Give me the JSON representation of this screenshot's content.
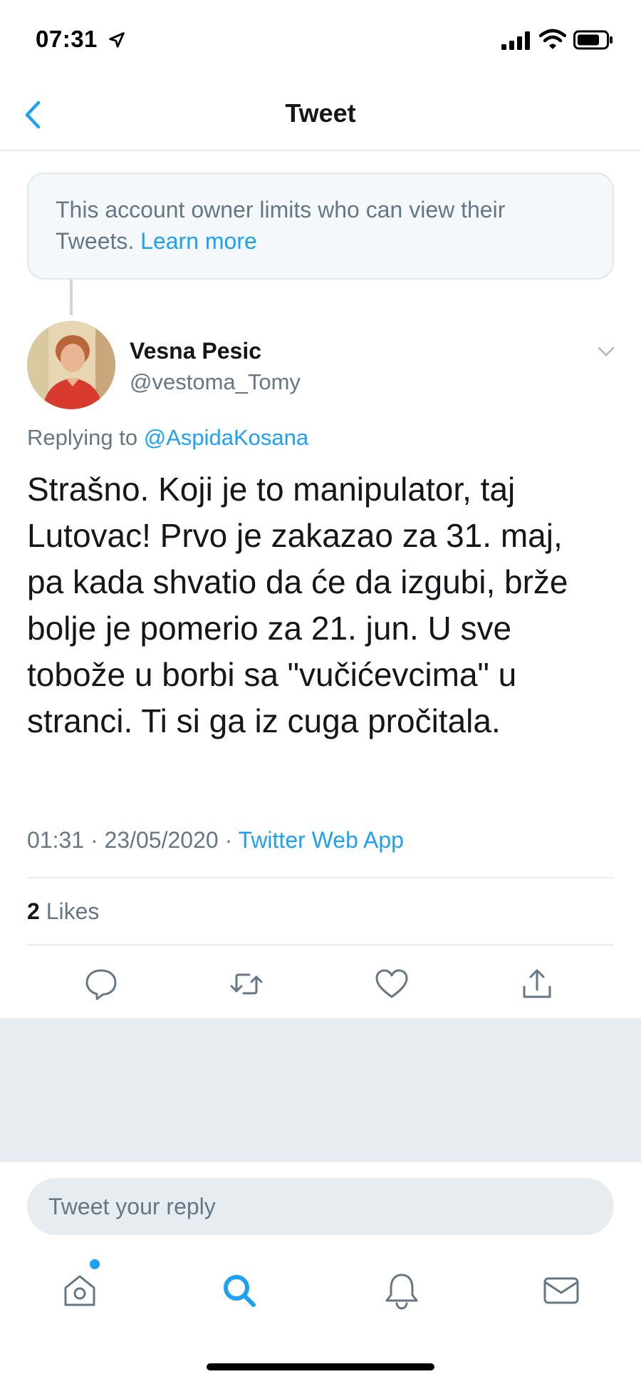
{
  "status_bar": {
    "time": "07:31"
  },
  "header": {
    "title": "Tweet"
  },
  "notice": {
    "text": "This account owner limits who can view their Tweets.",
    "link": "Learn more"
  },
  "tweet": {
    "author_name": "Vesna Pesic",
    "author_handle": "@vestoma_Tomy",
    "replying_prefix": "Replying to",
    "replying_to": "@AspidaKosana",
    "lines": [
      "Strašno. Koji je to manipulator, taj",
      "Lutovac! Prvo je zakazao za 31. maj,",
      "pa kada shvatio da će da izgubi, brže",
      "bolje je pomerio za 21. jun. U sve",
      "tobože u borbi sa \"vučićevcima\" u",
      "stranci. Ti si ga iz cuga pročitala."
    ],
    "time": "01:31",
    "date": "23/05/2020",
    "separator": "·",
    "source": "Twitter Web App",
    "likes_count": "2",
    "likes_label": "Likes"
  },
  "actions": {
    "reply": "comment-icon",
    "retweet": "retweet-icon",
    "like": "heart-icon",
    "share": "share-icon"
  },
  "reply_bar": {
    "placeholder": "Tweet your reply"
  },
  "tab_bar": {
    "items": [
      "home-icon",
      "search-icon",
      "notifications-icon",
      "messages-icon"
    ]
  },
  "colors": {
    "accent": "#1da1f2",
    "secondary_text": "#657786",
    "divider": "#e6ecf0"
  }
}
